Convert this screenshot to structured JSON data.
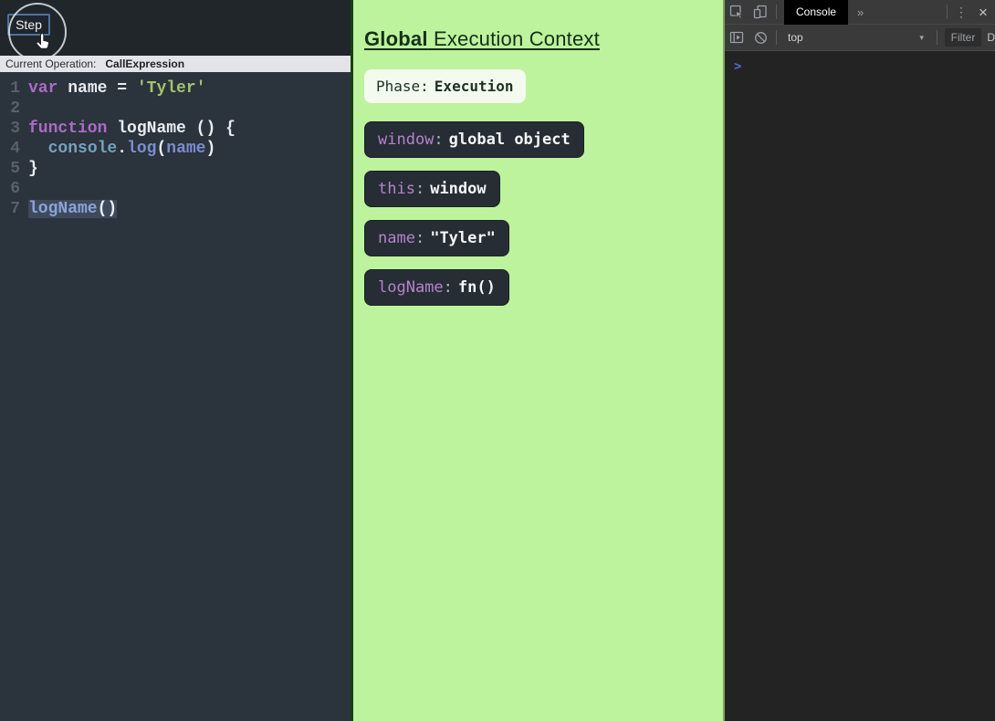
{
  "editor": {
    "step_button_label": "Step",
    "current_operation_label": "Current Operation:",
    "current_operation_value": "CallExpression",
    "code": {
      "lines": [
        {
          "num": "1",
          "tokens": [
            {
              "t": "var",
              "c": "kw"
            },
            {
              "t": " ",
              "c": "plain"
            },
            {
              "t": "name",
              "c": "plain"
            },
            {
              "t": " = ",
              "c": "plain"
            },
            {
              "t": "'Tyler'",
              "c": "str"
            }
          ]
        },
        {
          "num": "2",
          "tokens": []
        },
        {
          "num": "3",
          "tokens": [
            {
              "t": "function",
              "c": "kw"
            },
            {
              "t": " ",
              "c": "plain"
            },
            {
              "t": "logName",
              "c": "plain"
            },
            {
              "t": " () {",
              "c": "plain"
            }
          ]
        },
        {
          "num": "4",
          "tokens": [
            {
              "t": "  ",
              "c": "plain"
            },
            {
              "t": "console",
              "c": "obj"
            },
            {
              "t": ".",
              "c": "plain"
            },
            {
              "t": "log",
              "c": "fn"
            },
            {
              "t": "(",
              "c": "plain"
            },
            {
              "t": "name",
              "c": "arg"
            },
            {
              "t": ")",
              "c": "plain"
            }
          ]
        },
        {
          "num": "5",
          "tokens": [
            {
              "t": "}",
              "c": "plain"
            }
          ]
        },
        {
          "num": "6",
          "tokens": []
        },
        {
          "num": "7",
          "tokens": [
            {
              "t": "logName",
              "c": "call",
              "hl": true
            },
            {
              "t": "()",
              "c": "plain",
              "hl": true
            }
          ]
        }
      ]
    }
  },
  "context_panel": {
    "title_bold": "Global",
    "title_rest": " Execution Context",
    "phase_label": "Phase:",
    "phase_value": "Execution",
    "variables": [
      {
        "key": "window",
        "value": "global object"
      },
      {
        "key": "this",
        "value": "window"
      },
      {
        "key": "name",
        "value": "\"Tyler\""
      },
      {
        "key": "logName",
        "value": "fn()"
      }
    ]
  },
  "devtools": {
    "active_tab": "Console",
    "more_tabs_symbol": "»",
    "kebab_symbol": "⋮",
    "close_symbol": "×",
    "context_selector": "top",
    "context_caret": "▼",
    "filter_placeholder": "Filter",
    "levels_truncated": "D",
    "prompt_symbol": ">"
  },
  "colors": {
    "editor_bg": "#2b333c",
    "editor_header_bg": "#21262b",
    "operation_bar_bg": "#e4e4e8",
    "context_bg": "#bdf39c",
    "badge_bg": "#262d35",
    "badge_key": "#b583cb",
    "keyword_purple": "#ab6bc9",
    "string_green": "#a3c56c",
    "step_button_border": "#4d739c",
    "devtools_toolbar_bg": "#3a3a3a",
    "devtools_console_bg": "#232323",
    "prompt_blue": "#5468d9",
    "line_highlight": "#3e4a5c"
  }
}
